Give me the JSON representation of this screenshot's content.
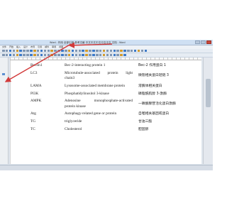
{
  "window": {
    "title": "Word - 作用 全部引用 参考文献 中文中文中文中文中文 文档 - Word"
  },
  "menu": [
    "文件",
    "开始",
    "插入",
    "设计",
    "布局",
    "引用",
    "邮件",
    "审阅",
    "视图"
  ],
  "rows": [
    {
      "abbr": "Beclin1",
      "eng": [
        "Bec-2-interacting protein 1"
      ],
      "chn": "Bec-2 作用蛋白 1"
    },
    {
      "abbr": "LC3",
      "eng": [
        "Microtubule-associated protein light",
        "chain3"
      ],
      "chn": "微管相关蛋白轻链 3"
    },
    {
      "abbr": "LAMA",
      "eng": [
        "Lysosome-associated membrane protein"
      ],
      "chn": "溶酶体相关蛋白"
    },
    {
      "abbr": "PI3K",
      "eng": [
        "Phosphatidylinositol 3-kinase"
      ],
      "chn": "磷脂酰肌醇 3-激酶"
    },
    {
      "abbr": "AMPK",
      "eng": [
        "Adenosine monophosphate-activated",
        "protein kinase"
      ],
      "chn": "一磷酸腺苷活化蛋白激酶"
    },
    {
      "abbr": "Atg",
      "eng": [
        "Autophagy-related gene or protein"
      ],
      "chn": "自噬相关基因或蛋白"
    },
    {
      "abbr": "TG",
      "eng": [
        "triglyceride"
      ],
      "chn": "甘油三酯"
    },
    {
      "abbr": "TC",
      "eng": [
        "Cholesterol"
      ],
      "chn": "胆固醇"
    }
  ],
  "colors": {
    "arrow": "#d23a3a",
    "titlebar": "#cfe0f3",
    "page": "#ffffff"
  }
}
